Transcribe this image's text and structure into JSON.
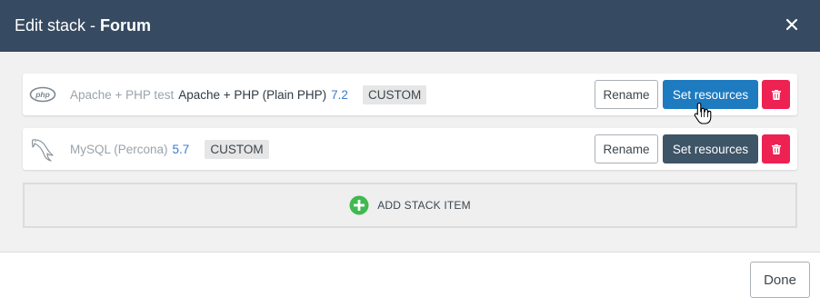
{
  "header": {
    "title_prefix": "Edit stack",
    "separator": "-",
    "title_name": "Forum",
    "close_icon": "close-icon"
  },
  "stack_items": [
    {
      "icon": "php-icon",
      "name": "Apache + PHP test",
      "type": "Apache + PHP (Plain PHP)",
      "version": "7.2",
      "badge": "CUSTOM",
      "rename_label": "Rename",
      "set_resources_label": "Set resources",
      "set_resources_state": "hover",
      "delete_icon": "trash-icon"
    },
    {
      "icon": "mysql-dolphin-icon",
      "name": "MySQL (Percona)",
      "version": "5.7",
      "badge": "CUSTOM",
      "rename_label": "Rename",
      "set_resources_label": "Set resources",
      "delete_icon": "trash-icon"
    }
  ],
  "add_stack": {
    "icon": "plus-circle-icon",
    "label": "ADD STACK ITEM"
  },
  "footer": {
    "done_label": "Done"
  },
  "colors": {
    "header_bg": "#364a61",
    "primary_blue": "#1e7bc0",
    "dark_button": "#3e5467",
    "danger": "#ee2153",
    "add_green": "#3fb950",
    "version_blue": "#3b7ccc"
  }
}
